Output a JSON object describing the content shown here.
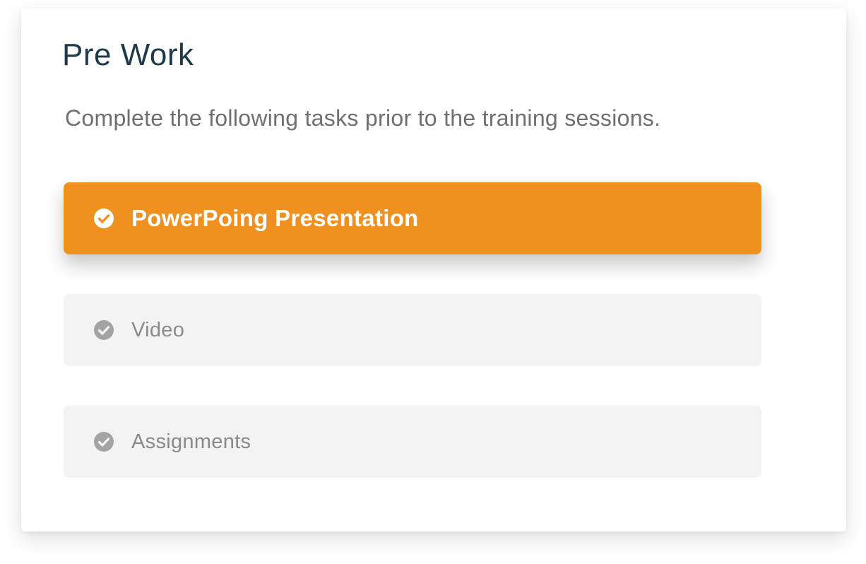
{
  "card": {
    "title": "Pre Work",
    "description": "Complete the following tasks prior to the training sessions."
  },
  "tasks": [
    {
      "label": "PowerPoing Presentation",
      "icon": "check-circle-icon",
      "state": "active",
      "completed": true
    },
    {
      "label": "Video",
      "icon": "check-circle-icon",
      "state": "inactive",
      "completed": true
    },
    {
      "label": "Assignments",
      "icon": "check-circle-icon",
      "state": "inactive",
      "completed": true
    }
  ],
  "colors": {
    "accent": "#f0901e",
    "title": "#1e3a4a",
    "inactive_bg": "#f3f3f3",
    "inactive_icon": "#a3a3a3"
  }
}
